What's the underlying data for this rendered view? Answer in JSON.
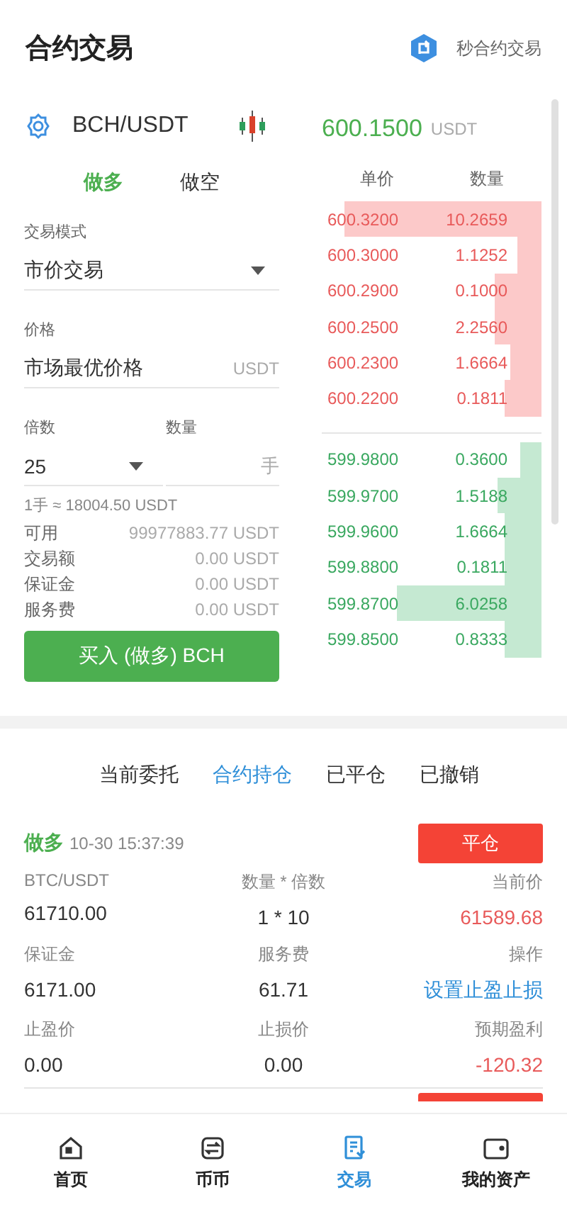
{
  "header": {
    "title": "合约交易",
    "action": "秒合约交易"
  },
  "pair": {
    "symbol": "BCH/USDT"
  },
  "side_tabs": [
    {
      "label": "做多",
      "selected": true
    },
    {
      "label": "做空",
      "selected": false
    }
  ],
  "last_price": {
    "value": "600.1500",
    "unit": "USDT"
  },
  "form": {
    "mode_label": "交易模式",
    "mode_value": "市价交易",
    "price_label": "价格",
    "price_placeholder": "市场最优价格",
    "price_unit": "USDT",
    "leverage_label": "倍数",
    "leverage_value": "25",
    "amount_label": "数量",
    "amount_unit": "手",
    "lot_note": "1手 ≈ 18004.50 USDT"
  },
  "summary": [
    {
      "label": "可用",
      "value": "99977883.77 USDT"
    },
    {
      "label": "交易额",
      "value": "0.00 USDT"
    },
    {
      "label": "保证金",
      "value": "0.00 USDT"
    },
    {
      "label": "服务费",
      "value": "0.00 USDT"
    }
  ],
  "buy_button": "买入 (做多) BCH",
  "order_book": {
    "columns": [
      "单价",
      "数量"
    ],
    "asks": [
      {
        "price": "600.3200",
        "amount": "10.2659"
      },
      {
        "price": "600.3000",
        "amount": "1.1252"
      },
      {
        "price": "600.2900",
        "amount": "0.1000"
      },
      {
        "price": "600.2500",
        "amount": "2.2560"
      },
      {
        "price": "600.2300",
        "amount": "1.6664"
      },
      {
        "price": "600.2200",
        "amount": "0.1811"
      }
    ],
    "bids": [
      {
        "price": "599.9800",
        "amount": "0.3600"
      },
      {
        "price": "599.9700",
        "amount": "1.5188"
      },
      {
        "price": "599.9600",
        "amount": "1.6664"
      },
      {
        "price": "599.8800",
        "amount": "0.1811"
      },
      {
        "price": "599.8700",
        "amount": "6.0258"
      },
      {
        "price": "599.8500",
        "amount": "0.8333"
      }
    ]
  },
  "order_tabs": [
    {
      "label": "当前委托",
      "selected": false
    },
    {
      "label": "合约持仓",
      "selected": true
    },
    {
      "label": "已平仓",
      "selected": false
    },
    {
      "label": "已撤销",
      "selected": false
    }
  ],
  "positions": [
    {
      "side": "做多",
      "time": "10-30 15:37:39",
      "close_button": "平仓",
      "cells": [
        {
          "label": "BTC/USDT",
          "value": "61710.00",
          "kind": "plain"
        },
        {
          "label": "数量 * 倍数",
          "value": "1 * 10",
          "kind": "plain"
        },
        {
          "label": "当前价",
          "value": "61589.68",
          "kind": "loss"
        },
        {
          "label": "保证金",
          "value": "6171.00",
          "kind": "plain"
        },
        {
          "label": "服务费",
          "value": "61.71",
          "kind": "plain"
        },
        {
          "label": "操作",
          "value": "设置止盈止损",
          "kind": "link"
        },
        {
          "label": "止盈价",
          "value": "0.00",
          "kind": "plain"
        },
        {
          "label": "止损价",
          "value": "0.00",
          "kind": "plain"
        },
        {
          "label": "预期盈利",
          "value": "-120.32",
          "kind": "loss"
        }
      ]
    }
  ],
  "nav": [
    {
      "label": "首页",
      "selected": false
    },
    {
      "label": "币币",
      "selected": false
    },
    {
      "label": "交易",
      "selected": true
    },
    {
      "label": "我的资产",
      "selected": false
    }
  ]
}
